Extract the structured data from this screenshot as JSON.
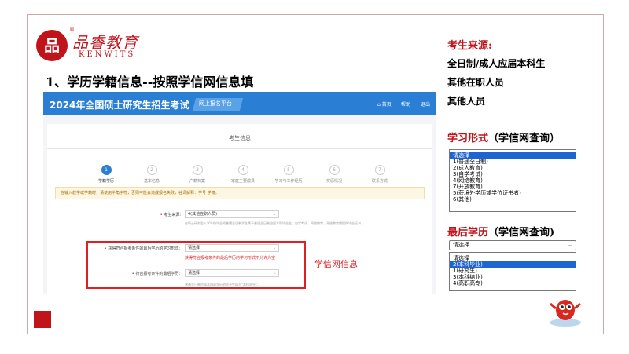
{
  "brand": {
    "logo_glyph": "品",
    "name_cn": "品睿教育",
    "name_en": "KENWITS",
    "reg_mark": "®"
  },
  "headline": "1、学历学籍信息--按照学信网信息填",
  "screenshot": {
    "site_title": "2024年全国硕士研究生招生考试",
    "tag": "网上报名平台",
    "nav": [
      "首页",
      "帮助",
      "退出"
    ],
    "card_title": "考生信息",
    "steps": [
      {
        "num": "1",
        "label": "学籍学历",
        "active": true
      },
      {
        "num": "2",
        "label": "基本信息",
        "active": false
      },
      {
        "num": "3",
        "label": "户籍档案",
        "active": false
      },
      {
        "num": "4",
        "label": "家庭主要成员",
        "active": false
      },
      {
        "num": "5",
        "label": "学习与工作经历",
        "active": false
      },
      {
        "num": "6",
        "label": "奖惩情况",
        "active": false
      },
      {
        "num": "7",
        "label": "联系方式",
        "active": false
      }
    ],
    "notice": "在输入教学或学籍时，请使用半角字符，否则可能会造成报名失败，谷词解释：学号 学籍。",
    "fields": {
      "source_label": "考生来源:",
      "source_value": "4(其他在职人员)",
      "source_help": "在职士研究生入学年份毕业的普通全日制学生属于普通全日制应届本科毕业生；自学考试、网络教育、开放教育需提供毕业证书。",
      "form_label": "获得符合报考条件的最后学历的学习形式:",
      "form_value": "请选择",
      "form_error": "获得符合报考条件的最后学历的学习形式不允许为空",
      "degree_label": "符合报考条件的最后学历:",
      "degree_value": "请选择",
      "degree_help": "普通全日制应届本科或学历的毕业生填写\"本科毕业\"。"
    },
    "annotation": "学信网信息"
  },
  "right_panel": {
    "source_heading": "考生来源:",
    "source_items": [
      "全日制/成人应届本科生",
      "其他在职人员",
      "其他人员"
    ],
    "form_heading_red": "学习形式",
    "form_heading_black": "（学信网查询）",
    "form_options": [
      "请选择",
      "1(普通全日制)",
      "2(成人教育)",
      "3(自学考试)",
      "4(网络教育)",
      "7(开放教育)",
      "5(获境外学历或学位证书者)",
      "6(其他)"
    ],
    "form_selected_index": 0,
    "degree_heading_red": "最后学历",
    "degree_heading_black": "（学信网查询)",
    "degree_value": "请选择",
    "degree_options": [
      "请选择",
      "2(本科毕业)",
      "1(研究生)",
      "3(本科结业)",
      "4(高职高专)"
    ],
    "degree_selected_index": 1
  },
  "colors": {
    "brand_red": "#c0141b",
    "site_blue": "#2a7fd4",
    "highlight": "#1e64d2",
    "error_red": "#e02020"
  }
}
